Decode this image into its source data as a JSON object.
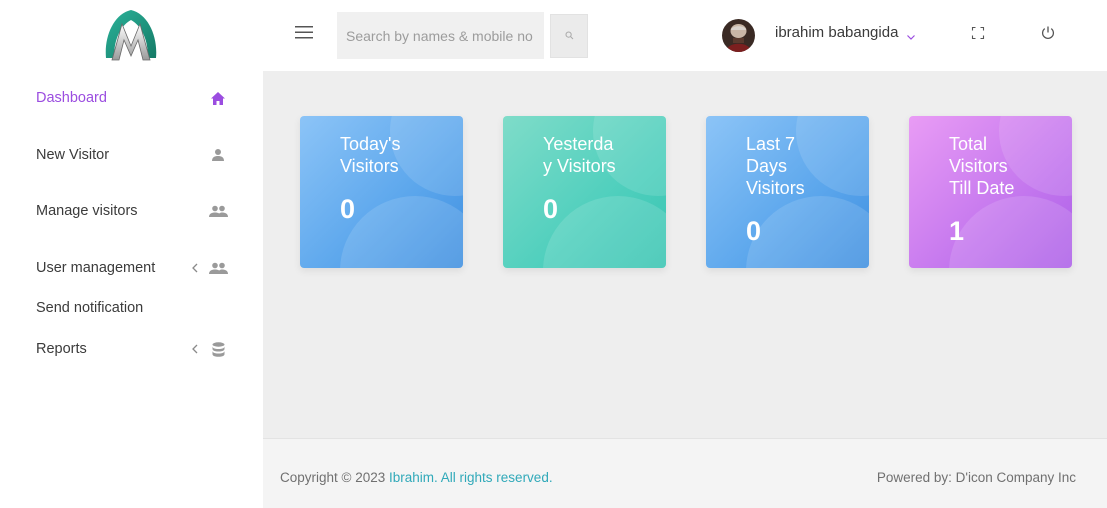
{
  "sidebar": {
    "items": [
      {
        "label": "Dashboard",
        "icon": "home-icon",
        "active": true
      },
      {
        "label": "New Visitor",
        "icon": "person-icon"
      },
      {
        "label": "Manage visitors",
        "icon": "people-icon"
      },
      {
        "label": "User management",
        "icon": "people-icon",
        "has_submenu": true
      },
      {
        "label": "Send notification"
      },
      {
        "label": "Reports",
        "icon": "database-icon",
        "has_submenu": true
      }
    ]
  },
  "topbar": {
    "search_placeholder": "Search by names & mobile no",
    "user_name": "ibrahim babangida"
  },
  "stats": [
    {
      "title": "Today's Visitors",
      "value": "0",
      "color": "#5ba6ec"
    },
    {
      "title": "Yesterda y Visitors",
      "value": "0",
      "color": "#4fcfbd"
    },
    {
      "title": "Last 7 Days Visitors",
      "value": "0",
      "color": "#5ba6ec"
    },
    {
      "title": "Total Visitors Till Date",
      "value": "1",
      "color": "#c477ee"
    }
  ],
  "footer": {
    "copyright_prefix": "Copyright © 2023 ",
    "copyright_brand": "Ibrahim. All rights reserved.",
    "powered_by": "Powered by: D'icon Company Inc"
  },
  "colors": {
    "accent": "#9b4de0",
    "link": "#30a9b9"
  }
}
